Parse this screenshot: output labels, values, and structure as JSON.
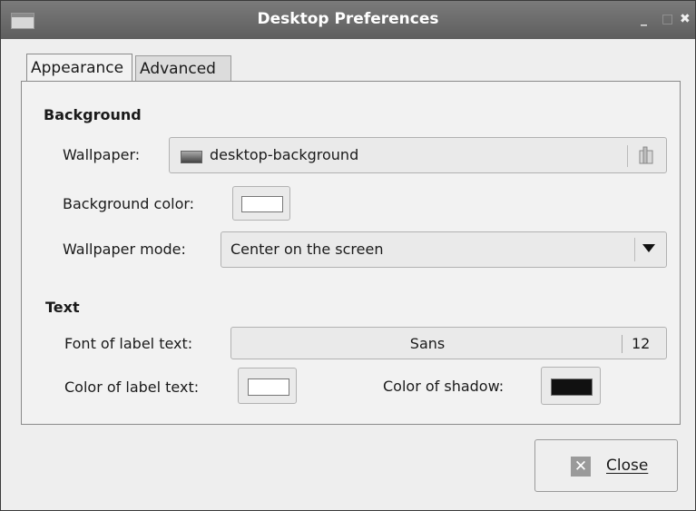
{
  "window": {
    "title": "Desktop Preferences",
    "controls": {
      "minimize": "_",
      "maximize": "□",
      "close": "✖"
    }
  },
  "tabs": [
    {
      "label": "Appearance",
      "active": true
    },
    {
      "label": "Advanced",
      "active": false
    }
  ],
  "background": {
    "heading": "Background",
    "wallpaper_label": "Wallpaper:",
    "wallpaper_value": "desktop-background",
    "color_label": "Background color:",
    "color_value": "#ffffff",
    "mode_label": "Wallpaper mode:",
    "mode_value": "Center on the screen"
  },
  "text": {
    "heading": "Text",
    "font_label": "Font of label text:",
    "font_name": "Sans",
    "font_size": "12",
    "label_color_label": "Color of label text:",
    "label_color_value": "#ffffff",
    "shadow_label": "Color of shadow:",
    "shadow_color_value": "#111111"
  },
  "footer": {
    "close_label": "Close",
    "close_icon": "close-icon"
  }
}
